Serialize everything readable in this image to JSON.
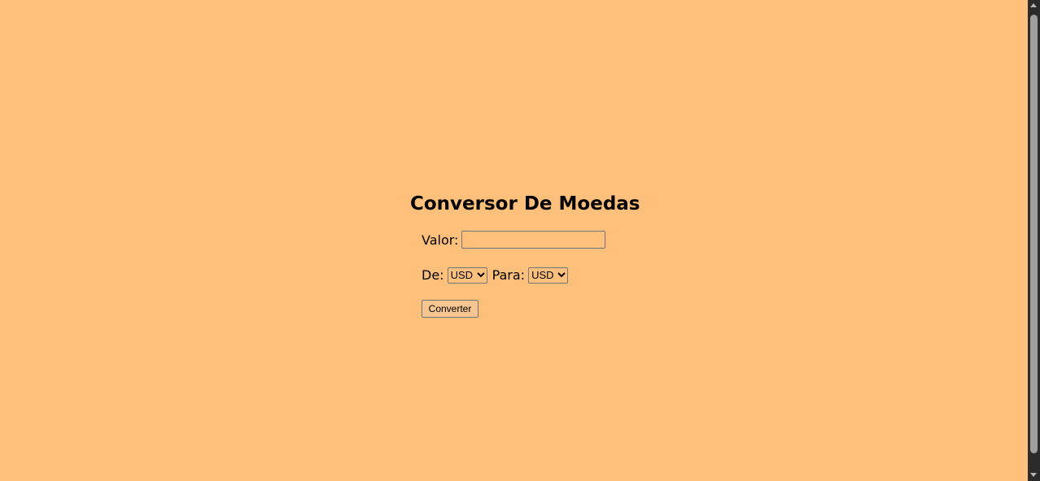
{
  "theme": {
    "background": "#ffc07c",
    "scrollbar_track": "#2b2b2b",
    "scrollbar_thumb": "#9f9f9f"
  },
  "title": "Conversor De Moedas",
  "form": {
    "valor_label": "Valor:",
    "valor_value": "",
    "de_label": "De:",
    "de_selected": "USD",
    "para_label": "Para:",
    "para_selected": "USD",
    "submit_label": "Converter"
  },
  "icons": {
    "select_arrow": "chevron-down-icon",
    "scroll_up": "triangle-up-icon",
    "scroll_down": "triangle-down-icon"
  }
}
